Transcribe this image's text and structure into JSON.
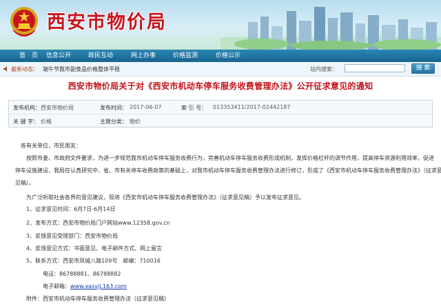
{
  "header": {
    "site_title": "西安市物价局"
  },
  "nav": {
    "items": [
      "首　页",
      "信息公开",
      "政民互动",
      "网上办事",
      "价格监测",
      "价格公示"
    ]
  },
  "ticker": {
    "label": "最新动态：",
    "text": "端午节我市副食品价格整体平稳",
    "search_label": "站内搜索：",
    "search_value": "",
    "search_button": "搜 索"
  },
  "article": {
    "title": "西安市物价局关于对《西安市机动车停车服务收费管理办法》公开征求意见的通知",
    "meta": {
      "publisher_label": "发布机构：",
      "publisher": "西安市物价局",
      "date_label": "发布时间：",
      "date": "2017-06-07",
      "index_label": "索 引 号：",
      "index": "013353411/2017-02442187",
      "keyword_label": "关 键 字：",
      "keyword": "价格",
      "category_label": "主题分类：",
      "category": "物价"
    },
    "salutation": "各有关单位，市民朋友：",
    "para1_line1": "按照市委、市政府文件要求，为进一步规范我市机动车停车服务收费行为，完善机动车停车服务收费形成机制，发挥价格杠杆的调节作用，提高停车资源利用效率，促进",
    "para1_line2": "停车设施建设，我局在认真研究中、省、市有关停车收费政策的基础上，对我市机动车停车服务收费管理办法进行修订，形成了《西安市机动车停车服务收费管理办法》（征求意",
    "para1_line3": "见稿）。",
    "para2": "为广泛听取社会各界的意见建议，现将《西安市机动车停车服务收费管理办法》（征求意见稿）予以发布征求意见。",
    "item1": "1、征求意见时间：6月7日-6月14日",
    "item2_prefix": "2、发布方式：西安市物价局门户网站",
    "item2_site": "www.12358.gov.cn",
    "item3": "3、反馈意见受理部门：西安市物价局",
    "item4": "4、反馈意见方式：书面意见、电子邮件方式、网上留言",
    "item5": "5、联系方式：西安市凤城八路109号　邮编：710016",
    "phone": "电话：86788881、86788882",
    "email_label": "电子邮箱：",
    "email": "www.xasvjj.163.com",
    "attachment": "附件：西安市机动车停车服务收费管理办法（征求意见稿）"
  },
  "colors": {
    "title_red": "#c21018",
    "nav_blue": "#1f78a8",
    "link_blue": "#0c34a8"
  }
}
